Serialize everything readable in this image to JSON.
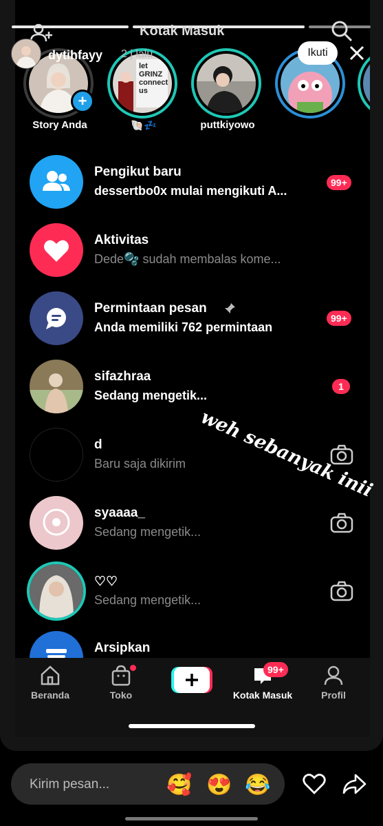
{
  "story_header": {
    "username": "dytihfayy",
    "time": "2 j lalu",
    "follow_label": "Ikuti"
  },
  "inbox": {
    "title": "Kotak Masuk"
  },
  "stories": [
    {
      "label": "Story Anda"
    },
    {
      "label": "🐚💤"
    },
    {
      "label": "puttkiyowo"
    },
    {
      "label": ""
    },
    {
      "label": ""
    }
  ],
  "story2_sign": "let GRINZ connect us",
  "list": [
    {
      "title": "Pengikut baru",
      "subtitle": "dessertbo0x mulai mengikuti A...",
      "badge": "99+",
      "icon": "people-icon",
      "color": "#20a4f3"
    },
    {
      "title": "Aktivitas",
      "subtitle": "Dede🫧 sudah membalas kome...",
      "badge": "",
      "icon": "heart-icon",
      "color": "#fe2c55"
    },
    {
      "title": "Permintaan pesan",
      "subtitle": "Anda memiliki 762 permintaan",
      "badge": "99+",
      "icon": "chat-icon",
      "color": "#3a4a86"
    },
    {
      "title": "sifazhraa",
      "subtitle": "Sedang mengetik...",
      "badge": "1"
    },
    {
      "title": "d",
      "subtitle": "Baru saja dikirim"
    },
    {
      "title": "syaaaa_",
      "subtitle": "Sedang mengetik..."
    },
    {
      "title": "♡♡",
      "subtitle": "Sedang mengetik..."
    },
    {
      "title": "Arsipkan",
      "subtitle": ""
    }
  ],
  "handwriting": "weh sebanyak inii",
  "nav": {
    "home": "Beranda",
    "shop": "Toko",
    "inbox": "Kotak Masuk",
    "inbox_badge": "99+",
    "profile": "Profil"
  },
  "reply": {
    "placeholder": "Kirim pesan...",
    "emojis": [
      "🥰",
      "😍",
      "😂"
    ]
  },
  "colors": {
    "accent": "#fe2c55",
    "ring": "#1ec8b6",
    "blue": "#20a4f3"
  }
}
